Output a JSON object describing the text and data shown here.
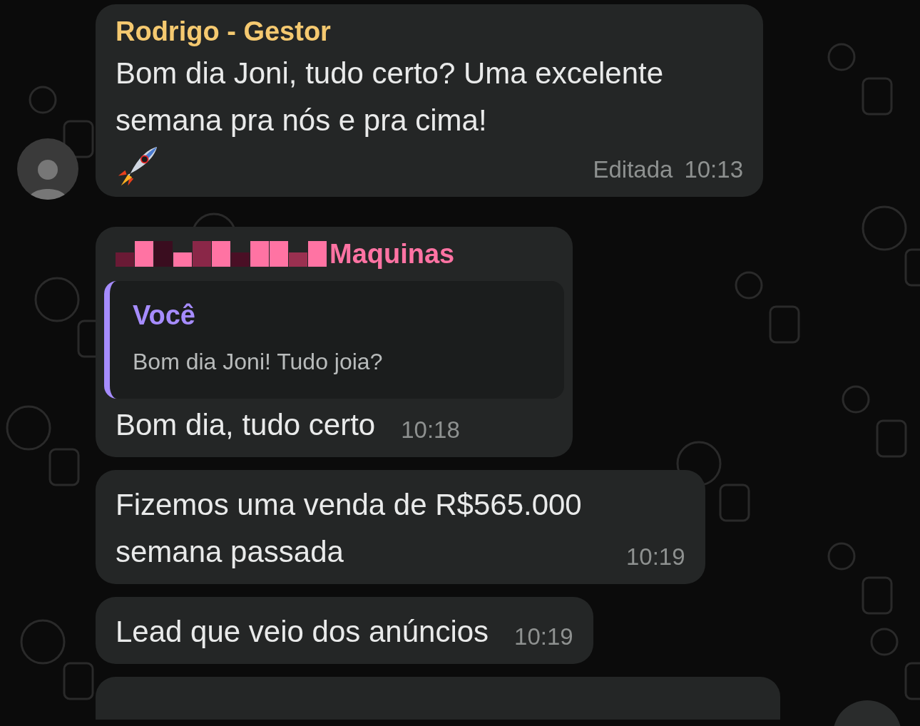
{
  "messages": [
    {
      "kind": "text",
      "sender": "Rodrigo - Gestor",
      "color": "#f5c970",
      "avatar": true,
      "text": "Bom dia Joni, tudo certo? Uma excelente semana pra nós e pra cima!",
      "emoji": true,
      "edited": "Editada",
      "time": "10:13"
    },
    {
      "kind": "reply",
      "sender": "Maquinas",
      "color": "#ff73a3",
      "redacted": true,
      "quote": {
        "author": "Você",
        "text": "Bom dia Joni! Tudo joia?"
      },
      "text": "Bom dia, tudo certo",
      "time": "10:18"
    },
    {
      "kind": "text",
      "text": "Fizemos uma venda de R$565.000 semana passada",
      "time": "10:19"
    },
    {
      "kind": "text",
      "text": "Lead que veio dos anúncios",
      "time": "10:19"
    }
  ]
}
